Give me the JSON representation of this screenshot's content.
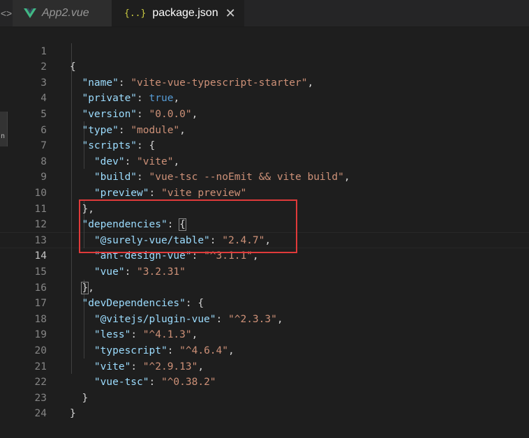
{
  "tabs": {
    "left_edge_icon": "chevrons-icon",
    "app2": {
      "label": "App2.vue",
      "icon": "vue-icon",
      "icon_color": "#41b883"
    },
    "package": {
      "label": "package.json",
      "icon_text": "{..}",
      "close_glyph": "✕"
    }
  },
  "gutter": [
    "1",
    "2",
    "3",
    "4",
    "5",
    "6",
    "7",
    "8",
    "9",
    "10",
    "11",
    "12",
    "13",
    "14",
    "15",
    "16",
    "17",
    "18",
    "19",
    "20",
    "21",
    "22",
    "23",
    "24"
  ],
  "active_line": 14,
  "code": {
    "l1": {
      "t1": "{"
    },
    "l2": {
      "k": "\"name\"",
      "c": ": ",
      "v": "\"vite-vue-typescript-starter\"",
      "e": ","
    },
    "l3": {
      "k": "\"private\"",
      "c": ": ",
      "v": "true",
      "e": ","
    },
    "l4": {
      "k": "\"version\"",
      "c": ": ",
      "v": "\"0.0.0\"",
      "e": ","
    },
    "l5": {
      "k": "\"type\"",
      "c": ": ",
      "v": "\"module\"",
      "e": ","
    },
    "l6": {
      "k": "\"scripts\"",
      "c": ": ",
      "e": "{"
    },
    "l7": {
      "k": "\"dev\"",
      "c": ": ",
      "v": "\"vite\"",
      "e": ","
    },
    "l8": {
      "k": "\"build\"",
      "c": ": ",
      "v": "\"vue-tsc --noEmit && vite build\"",
      "e": ","
    },
    "l9": {
      "k": "\"preview\"",
      "c": ": ",
      "v": "\"vite preview\""
    },
    "l10": {
      "t1": "},"
    },
    "l11": {
      "k": "\"dependencies\"",
      "c": ": ",
      "e": "{"
    },
    "l12": {
      "k": "\"@surely-vue/table\"",
      "c": ": ",
      "v": "\"2.4.7\"",
      "e": ","
    },
    "l13": {
      "k": "\"ant-design-vue\"",
      "c": ": ",
      "v": "\"^3.1.1\"",
      "e": ","
    },
    "l14": {
      "k": "\"vue\"",
      "c": ": ",
      "v": "\"3.2.31\""
    },
    "l15": {
      "b": "}",
      "e": ","
    },
    "l16": {
      "k": "\"devDependencies\"",
      "c": ": ",
      "e": "{"
    },
    "l17": {
      "k": "\"@vitejs/plugin-vue\"",
      "c": ": ",
      "v": "\"^2.3.3\"",
      "e": ","
    },
    "l18": {
      "k": "\"less\"",
      "c": ": ",
      "v": "\"^4.1.3\"",
      "e": ","
    },
    "l19": {
      "k": "\"typescript\"",
      "c": ": ",
      "v": "\"^4.6.4\"",
      "e": ","
    },
    "l20": {
      "k": "\"vite\"",
      "c": ": ",
      "v": "\"^2.9.13\"",
      "e": ","
    },
    "l21": {
      "k": "\"vue-tsc\"",
      "c": ": ",
      "v": "\"^0.38.2\""
    },
    "l22": {
      "t1": "}"
    },
    "l23": {
      "t1": "}"
    }
  },
  "colors": {
    "key": "#9cdcfe",
    "string": "#ce9178",
    "boolean": "#569cd6",
    "annotation_box": "#e03a3a"
  }
}
